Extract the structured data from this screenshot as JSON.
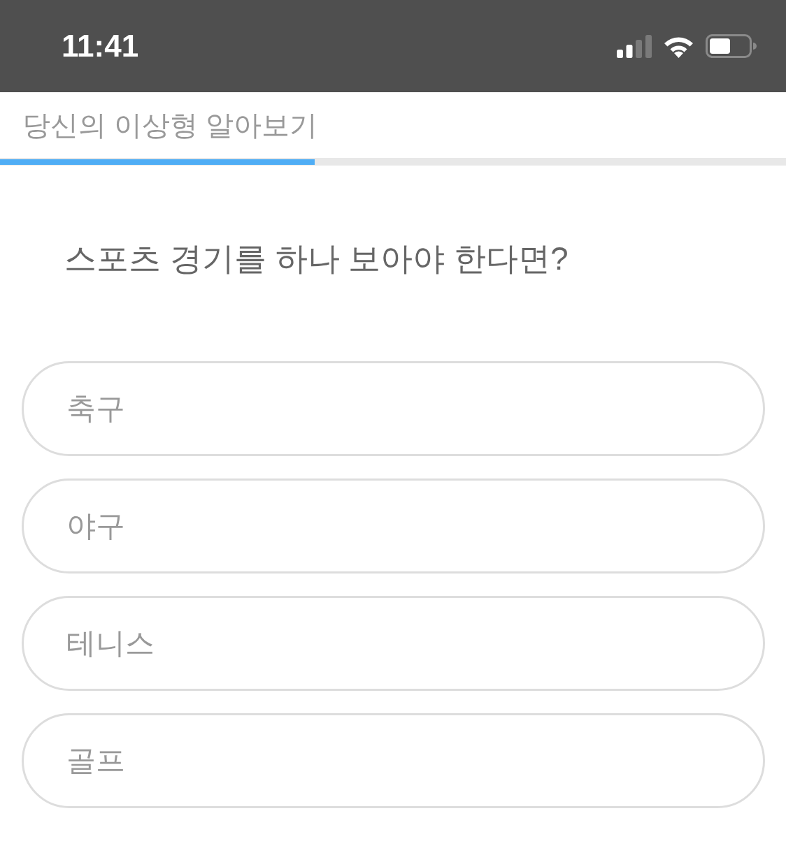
{
  "status_bar": {
    "time": "11:41"
  },
  "header": {
    "title": "당신의 이상형 알아보기"
  },
  "progress": {
    "level": 0.4
  },
  "question": {
    "text": "스포츠 경기를 하나 보아야 한다면?"
  },
  "options": [
    {
      "label": "축구",
      "selected": false
    },
    {
      "label": "야구",
      "selected": false
    },
    {
      "label": "테니스",
      "selected": false
    },
    {
      "label": "골프",
      "selected": false
    }
  ]
}
